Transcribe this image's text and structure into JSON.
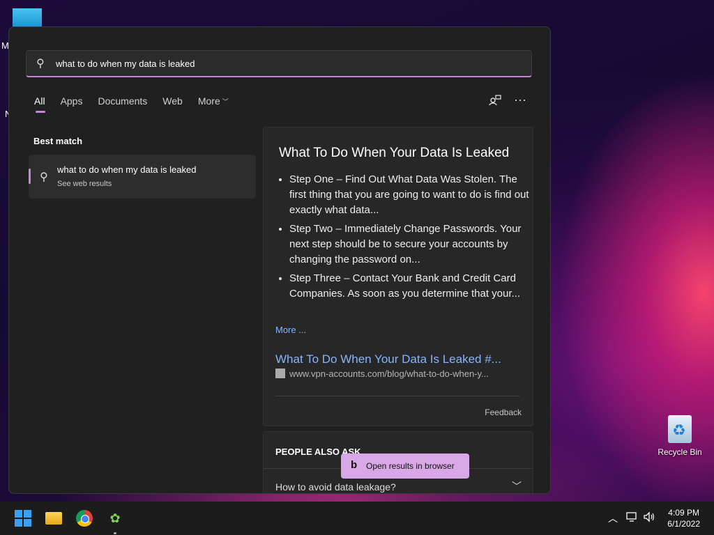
{
  "desktop": {
    "letters": [
      "M",
      "N"
    ],
    "recycle_bin_label": "Recycle Bin"
  },
  "search": {
    "query": "what to do when my data is leaked",
    "tabs": [
      {
        "label": "All",
        "active": true
      },
      {
        "label": "Apps"
      },
      {
        "label": "Documents"
      },
      {
        "label": "Web"
      },
      {
        "label": "More"
      }
    ]
  },
  "best_match": {
    "heading": "Best match",
    "title": "what to do when my data is leaked",
    "subtitle": "See web results"
  },
  "preview": {
    "title": "What To Do When Your Data Is Leaked",
    "steps": [
      "Step One – Find Out What Data Was Stolen. The first thing that you are going to want to do is find out exactly what data...",
      "Step Two – Immediately Change Passwords. Your next step should be to secure your accounts by changing the password on...",
      "Step Three – Contact Your Bank and Credit Card Companies. As soon as you determine that your..."
    ],
    "more_label": "More ...",
    "result_title": "What To Do When Your Data Is Leaked #...",
    "result_url": "www.vpn-accounts.com/blog/what-to-do-when-y...",
    "feedback_label": "Feedback"
  },
  "people_also_ask": {
    "heading": "PEOPLE ALSO ASK",
    "question": "How to avoid data leakage?"
  },
  "open_in_browser": {
    "label": "Open results in browser",
    "icon": "bing-icon"
  },
  "taskbar": {
    "time": "4:09 PM",
    "date": "6/1/2022",
    "apps": [
      "windows-start-icon",
      "file-explorer-icon",
      "chrome-icon",
      "app-icon"
    ]
  },
  "colors": {
    "accent": "#c48ad6",
    "link": "#8ab4f8",
    "panel_bg": "#202020"
  }
}
